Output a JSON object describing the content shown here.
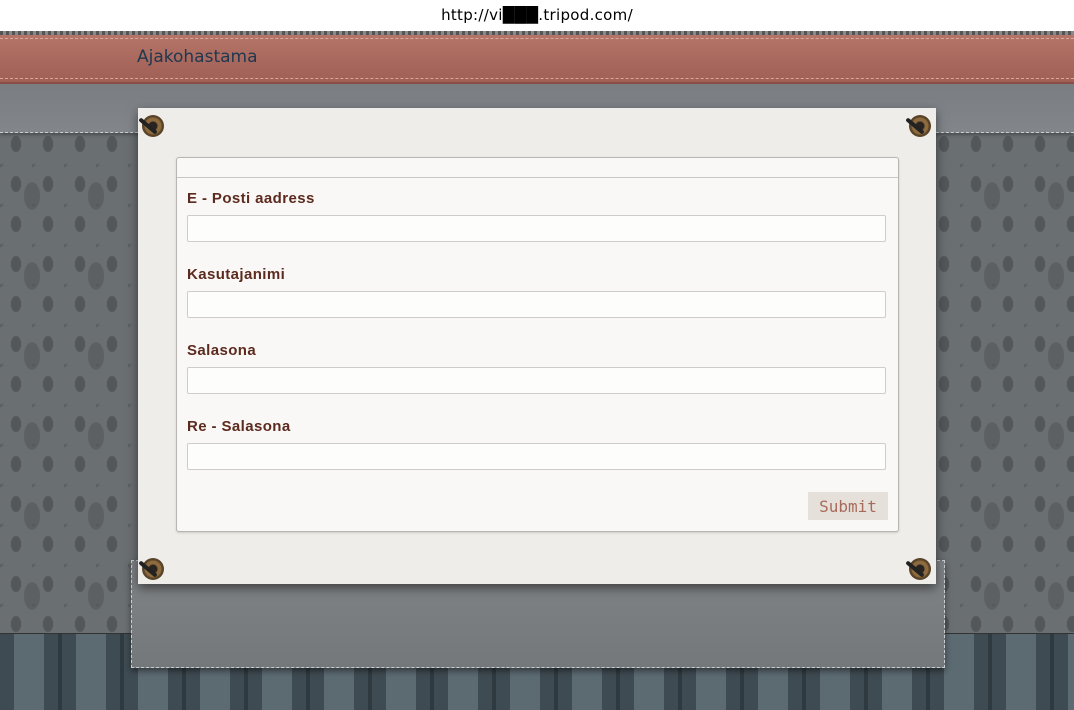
{
  "browser": {
    "url": "http://vi███.tripod.com/"
  },
  "header": {
    "site_title": "Ajakohastama"
  },
  "form": {
    "fields": [
      {
        "label": "E - Posti aadress",
        "value": ""
      },
      {
        "label": "Kasutajanimi",
        "value": ""
      },
      {
        "label": "Salasona",
        "value": ""
      },
      {
        "label": "Re - Salasona",
        "value": ""
      }
    ],
    "submit_label": "Submit"
  },
  "colors": {
    "header": "#a8675c",
    "label": "#5c2a1e",
    "title": "#1e3850"
  }
}
